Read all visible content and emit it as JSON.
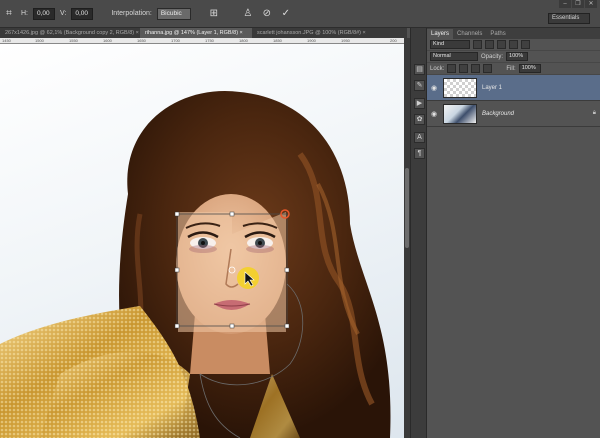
{
  "options_bar": {
    "h_label": "H:",
    "h_value": "0,00",
    "v_label": "V:",
    "v_value": "0,00",
    "interpolation_label": "Interpolation:",
    "interpolation_value": "Bicubic",
    "icons": [
      "h-skew-icon",
      "v-skew-icon",
      "warp-mode-icon",
      "cancel-transform-icon",
      "commit-transform-icon"
    ],
    "workspace": "Essentials"
  },
  "window_controls": [
    "minimize",
    "restore",
    "close"
  ],
  "doc_tabs": [
    {
      "label": "267x1426.jpg @ 62,1% (Background copy 2, RGB/8) ×",
      "active": false
    },
    {
      "label": "rihanna.jpg @ 147% (Layer 1, RGB/8) ×",
      "active": true
    },
    {
      "label": "scarlett johansson.JPG @ 100% (RGB/8#) ×",
      "active": false
    }
  ],
  "ruler_ticks": [
    "1450",
    "1500",
    "1550",
    "1600",
    "1650",
    "1700",
    "1750",
    "1800",
    "1850",
    "1900",
    "1950",
    "200"
  ],
  "layers_panel": {
    "tabs": [
      "Layers",
      "Channels",
      "Paths"
    ],
    "kind_label": "Kind",
    "blend_mode": "Normal",
    "opacity_label": "Opacity:",
    "opacity_value": "100%",
    "lock_label": "Lock:",
    "fill_label": "Fill:",
    "fill_value": "100%",
    "layers": [
      {
        "name": "Layer 1",
        "selected": true,
        "visible": true,
        "locked": false
      },
      {
        "name": "Background",
        "selected": false,
        "visible": true,
        "locked": true
      }
    ]
  },
  "colors": {
    "app_bg": "#535353",
    "selected_layer": "#5a6d8a",
    "transform_handle": "#e8572a",
    "cursor_highlight": "#f5d21e"
  }
}
